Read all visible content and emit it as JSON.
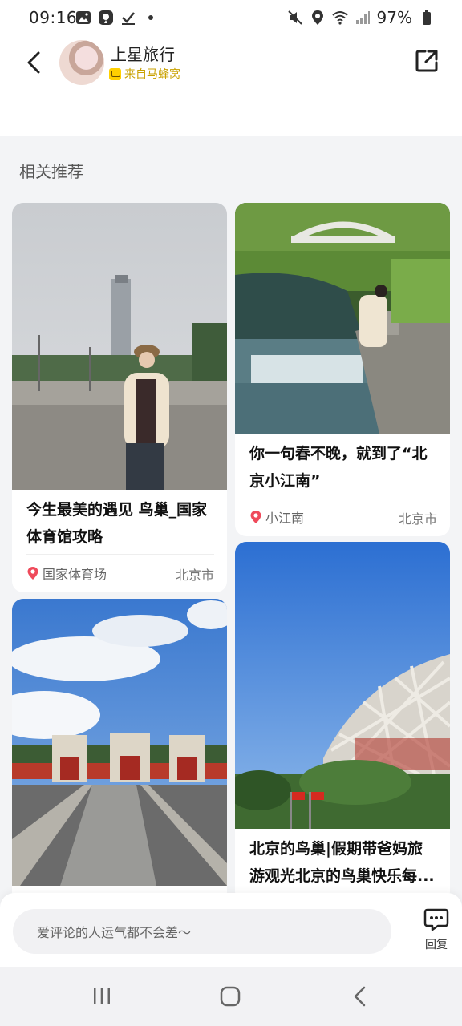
{
  "status_bar": {
    "time": "09:16",
    "battery": "97%"
  },
  "header": {
    "title": "上星旅行",
    "source": "来自马蜂窝"
  },
  "section_title": "相关推荐",
  "cards": [
    {
      "title": "今生最美的遇见 鸟巢_国家体育馆攻略",
      "location": "国家体育场",
      "city": "北京市"
    },
    {
      "title": "你一句春不晚，就到了“北京小江南”",
      "location": "小江南",
      "city": "北京市"
    },
    {
      "title": ""
    },
    {
      "title": "北京的鸟巢|假期带爸妈旅游观光北京的鸟巢快乐每..."
    }
  ],
  "comment_bar": {
    "placeholder": "爱评论的人运气都不会差～",
    "reply_label": "回复"
  },
  "colors": {
    "accent_yellow": "#ffd000",
    "pin_red": "#ef4a5b"
  }
}
